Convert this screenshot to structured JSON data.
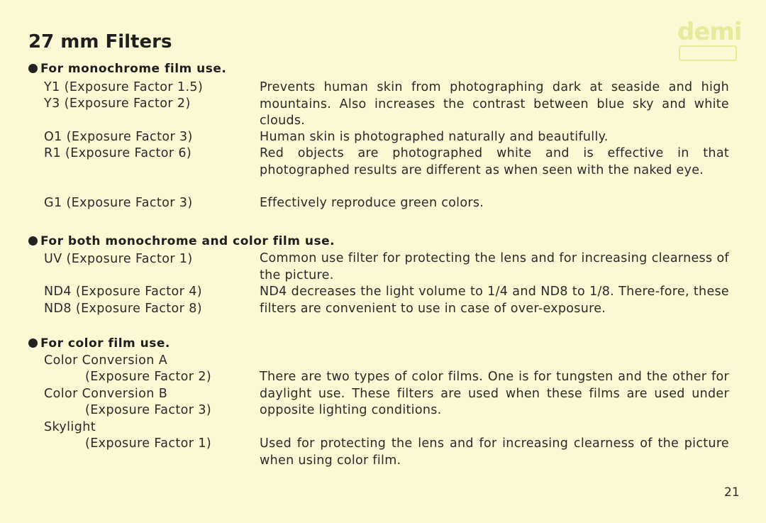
{
  "title": "27 mm Filters",
  "logo": "demi",
  "page_number": "21",
  "sections": [
    {
      "heading": "For monochrome film use.",
      "left": [
        "Y1 (Exposure Factor 1.5)",
        "Y3 (Exposure Factor 2)",
        "O1 (Exposure Factor 3)",
        "R1 (Exposure Factor 6)",
        "G1 (Exposure Factor 3)"
      ],
      "right": [
        "Prevents human skin from photographing dark at seaside and high mountains. Also increases the contrast between blue sky and white clouds.",
        "Human skin is photographed naturally and beautifully.",
        "Red objects are photographed white and is effective in that photographed results are different as when seen with the naked eye.",
        "Effectively reproduce green colors."
      ]
    },
    {
      "heading": "For both monochrome and color film use.",
      "left": [
        "UV (Exposure Factor 1)",
        "ND4 (Exposure Factor 4)",
        "ND8 (Exposure Factor 8)"
      ],
      "right": [
        "Common use filter for protecting the lens and for increasing clearness of the picture.",
        "ND4 decreases the light volume to 1/4 and ND8 to 1/8. There-fore, these filters are convenient to use in case of over-exposure."
      ]
    },
    {
      "heading": "For color film use.",
      "left": [
        "Color Conversion A",
        "(Exposure Factor 2)",
        "Color Conversion B",
        "(Exposure Factor 3)",
        "Skylight",
        "(Exposure Factor 1)"
      ],
      "right": [
        "There are two types of color films. One is for tungsten and the other for daylight use. These filters are used when these films are used under opposite lighting conditions.",
        "Used for protecting the lens and for increasing clearness of the picture when using color film."
      ]
    }
  ]
}
